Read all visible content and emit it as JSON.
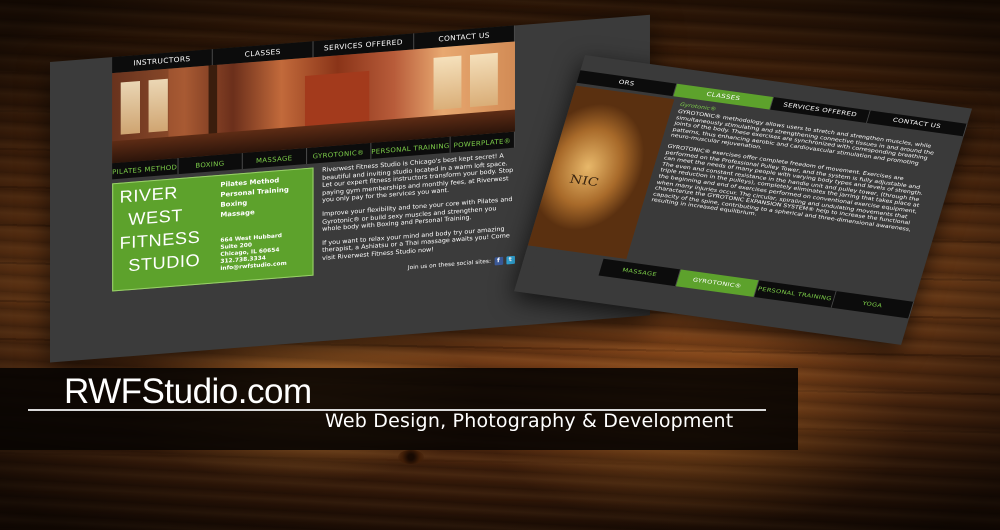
{
  "left_card": {
    "tabs": [
      "INSTRUCTORS",
      "CLASSES",
      "SERVICES OFFERED",
      "CONTACT US"
    ],
    "sub_tabs": [
      "PILATES METHOD",
      "BOXING",
      "MASSAGE",
      "GYROTONIC®",
      "PERSONAL TRAINING",
      "POWERPLATE®"
    ],
    "logo": {
      "line1": "RIVER",
      "line2": "WEST",
      "line3": "FITNESS",
      "line4": "STUDIO",
      "menu": [
        "Pilates Method",
        "Personal Training",
        "Boxing",
        "Massage"
      ],
      "address": [
        "664 West Hubbard",
        "Suite 200",
        "Chicago, IL 60654",
        "312.738.3334",
        "info@rwfstudio.com"
      ]
    },
    "paragraphs": [
      "Riverwest Fitness Studio is Chicago's best kept secret! A beautiful and inviting studio located in a warm loft space. Let our expert fitness instructors transform your body. Stop paying gym memberships and monthly fees, at Riverwest you only pay for the services you want.",
      "Improve your flexibility and tone your core with Pilates and Gyrotonic® or build sexy muscles and strengthen you whole body with Boxing and Personal Training.",
      "If you want to relax your mind and body try our amazing therapist, a Ashiatsu or a Thai massage awaits you! Come visit Riverwest Fitness Studio now!"
    ],
    "social_label": "Join us on these social sites:",
    "social_icons": [
      "facebook-icon",
      "twitter-icon"
    ]
  },
  "right_card": {
    "tabs": [
      "ORS",
      "CLASSES",
      "SERVICES OFFERED",
      "CONTACT US"
    ],
    "photo_text": "NIC",
    "section_title": "Gyrotonic®",
    "paragraphs": [
      "GYROTONIC® methodology allows users to stretch and strengthen muscles, while simultaneously stimulating and strengthening connective tissues in and around the joints of the body. These exercises are synchronized with corresponding breathing patterns, thus enhancing aerobic and cardiovascular stimulation and promoting neuro-muscular rejuvenation.",
      "GYROTONIC® exercises offer complete freedom of movement. Exercises are performed on the Professional Pulley Tower, and the system is fully adjustable and can meet the needs of many people with varying body types and levels of strength. The even and constant resistance in the handle unit and pulley tower, (through the triple reduction in the pulleys), completely eliminates the jarring that takes place at the beginning and end of exercises performed on conventional exercise equipment, when many injuries occur. The circular, spiraling and undulating movements that characterize the GYROTONIC EXPANSION SYSTEM® help to increase the functional capacity of the spine, contributing to a spherical and three-dimensional awareness, resulting in increased equilibrium."
    ],
    "sub_tabs": [
      "MASSAGE",
      "GYROTONIC®",
      "PERSONAL TRAINING",
      "YOGA"
    ]
  },
  "banner": {
    "brand": "RWFStudio.com",
    "tagline": "Web Design, Photography & Development"
  },
  "colors": {
    "accent_green": "#5da22c",
    "card_gray": "#3b3b3b",
    "tab_black": "#0c0c0c"
  }
}
